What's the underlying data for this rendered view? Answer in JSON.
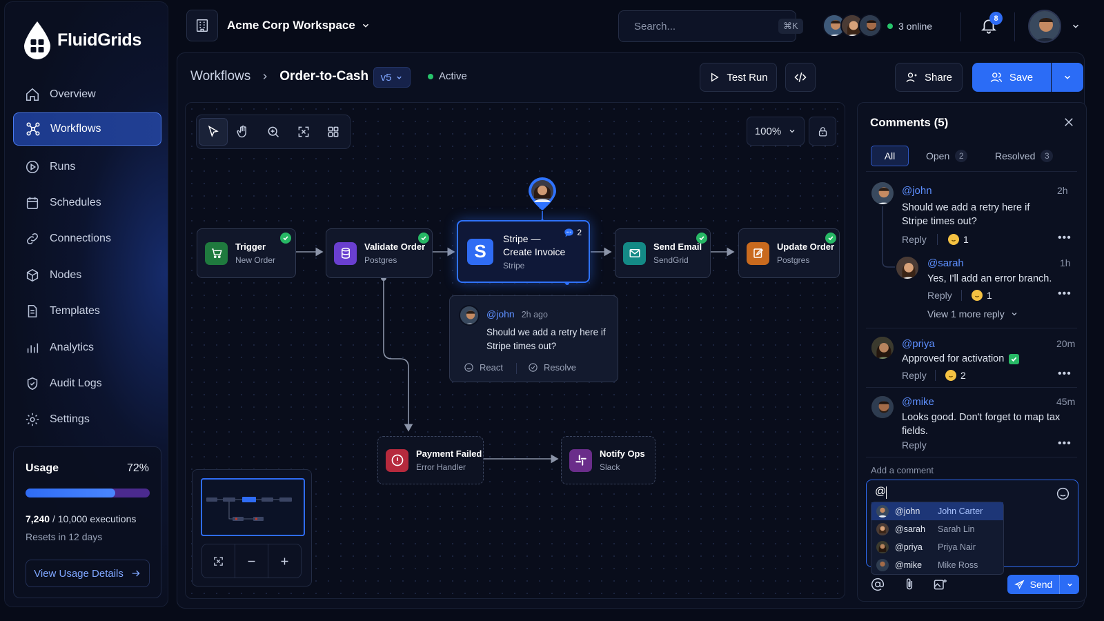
{
  "brand": {
    "name": "FluidGrids",
    "logo_icon": "droplet-grid-logo"
  },
  "sidebar": {
    "items": [
      {
        "label": "Overview",
        "icon": "home-icon"
      },
      {
        "label": "Workflows",
        "icon": "workflow-icon",
        "active": true
      },
      {
        "label": "Runs",
        "icon": "play-circle-icon"
      },
      {
        "label": "Schedules",
        "icon": "calendar-icon"
      },
      {
        "label": "Connections",
        "icon": "link-icon"
      },
      {
        "label": "Nodes",
        "icon": "cube-icon"
      },
      {
        "label": "Templates",
        "icon": "document-icon"
      },
      {
        "label": "Analytics",
        "icon": "bar-chart-icon"
      },
      {
        "label": "Audit Logs",
        "icon": "shield-icon"
      },
      {
        "label": "Settings",
        "icon": "gear-icon"
      }
    ],
    "usage": {
      "title": "Usage",
      "percent_label": "72%",
      "percent": 0.72,
      "used": "7,240",
      "total_label": "/ 10,000 executions",
      "reset": "Resets in 12 days",
      "button": "View Usage Details"
    }
  },
  "topbar": {
    "workspace": "Acme Corp Workspace",
    "search_placeholder": "Search...",
    "search_shortcut": "⌘K",
    "online": "3 online",
    "notifications": "8"
  },
  "header": {
    "breadcrumb_root": "Workflows",
    "breadcrumb_current": "Order-to-Cash",
    "version": "v5",
    "status": "Active",
    "test_run": "Test Run",
    "share": "Share",
    "save": "Save"
  },
  "canvas": {
    "zoom": "100%",
    "nodes": [
      {
        "title": "Trigger",
        "subtitle": "New Order"
      },
      {
        "title": "Validate Order",
        "subtitle": "Postgres"
      },
      {
        "title": "Stripe —\nCreate Invoice",
        "subtitle": "Stripe",
        "comment_count": "2"
      },
      {
        "title": "Send Email",
        "subtitle": "SendGrid"
      },
      {
        "title": "Update Order",
        "subtitle": "Postgres"
      },
      {
        "title": "Payment Failed",
        "subtitle": "Error Handler"
      },
      {
        "title": "Notify Ops",
        "subtitle": "Slack"
      }
    ],
    "popover": {
      "handle": "@john",
      "time": "2h ago",
      "text": "Should we add a retry here if Stripe times out?",
      "react": "React",
      "resolve": "Resolve"
    }
  },
  "comments": {
    "title": "Comments (5)",
    "tabs": [
      {
        "label": "All"
      },
      {
        "label": "Open",
        "count": "2"
      },
      {
        "label": "Resolved",
        "count": "3"
      }
    ],
    "items": [
      {
        "handle": "@john",
        "time": "2h",
        "text": "Should we add a retry here if Stripe times out?",
        "reply": "Reply",
        "reactions": "1"
      },
      {
        "handle": "@sarah",
        "time": "1h",
        "text": "Yes, I'll add an error branch.",
        "reply": "Reply",
        "reactions": "1"
      },
      {
        "handle": "@priya",
        "time": "20m",
        "text": "Approved for activation",
        "reply": "Reply",
        "reactions": "2"
      },
      {
        "handle": "@mike",
        "time": "45m",
        "text": "Looks good. Don't forget to map tax fields.",
        "reply": "Reply"
      }
    ],
    "view_more": "View 1 more reply",
    "add_label": "Add a comment",
    "input_value": "@",
    "mentions": [
      {
        "handle": "@john",
        "name": "John Carter"
      },
      {
        "handle": "@sarah",
        "name": "Sarah Lin"
      },
      {
        "handle": "@priya",
        "name": "Priya Nair"
      },
      {
        "handle": "@mike",
        "name": "Mike Ross"
      }
    ],
    "send": "Send"
  },
  "colors": {
    "accent": "#2b6cf6",
    "success": "#27b865",
    "background": "#070b18"
  }
}
